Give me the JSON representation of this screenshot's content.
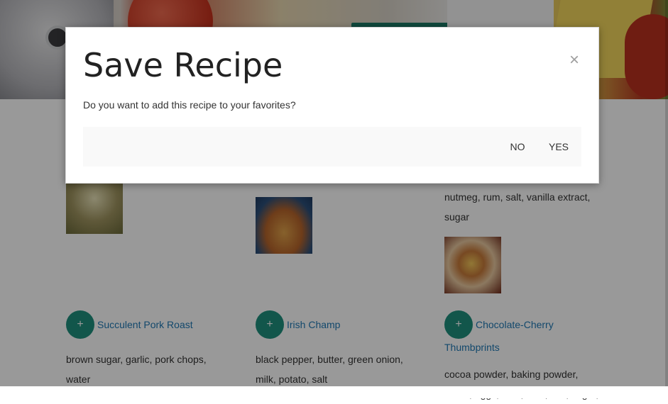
{
  "modal": {
    "title": "Save Recipe",
    "message": "Do you want to add this recipe to your favorites?",
    "close_icon": "×",
    "no_label": "NO",
    "yes_label": "YES"
  },
  "recipes": [
    {
      "name": "Succulent Pork Roast",
      "ingredients": "brown sugar, garlic, pork chops, water",
      "add_label": "+"
    },
    {
      "name": "Irish Champ",
      "ingredients": "black pepper, butter, green onion, milk, potato, salt",
      "add_label": "+"
    },
    {
      "name": "Chocolate-Cherry Thumbprints",
      "ingredients": "cocoa powder, baking powder, butter, eggs, flour, oats, salt, sugar,",
      "add_label": "+"
    }
  ],
  "partial_ingredients": "nutmeg, rum, salt, vanilla extract, sugar",
  "colors": {
    "accent": "#1f8f7e",
    "link": "#1f78b4",
    "overlay": "rgba(0,0,0,0.40)"
  }
}
